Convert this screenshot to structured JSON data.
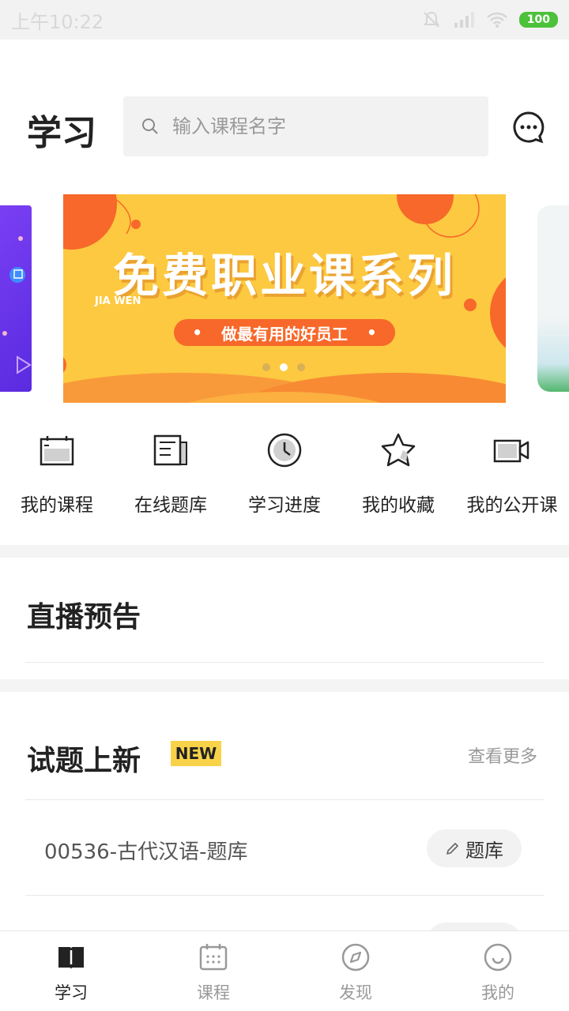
{
  "status_bar": {
    "time": "上午10:22",
    "battery": "100"
  },
  "header": {
    "title": "学习",
    "search_placeholder": "输入课程名字"
  },
  "banner": {
    "headline": "免费职业课系列",
    "subtext": "JIA WEN",
    "tagline": "做最有用的好员工",
    "active_dot": 1
  },
  "shortcuts": [
    {
      "label": "我的课程",
      "icon": "course-icon"
    },
    {
      "label": "在线题库",
      "icon": "question-bank-icon"
    },
    {
      "label": "学习进度",
      "icon": "clock-icon"
    },
    {
      "label": "我的收藏",
      "icon": "star-icon"
    },
    {
      "label": "我的公开课",
      "icon": "video-camera-icon"
    }
  ],
  "live": {
    "title": "直播预告"
  },
  "new_questions": {
    "title": "试题上新",
    "badge": "NEW",
    "more": "查看更多",
    "items": [
      {
        "title": "00536-古代汉语-题库",
        "tag": "题库"
      }
    ]
  },
  "tabbar": [
    {
      "label": "学习",
      "icon": "book-icon",
      "active": true
    },
    {
      "label": "课程",
      "icon": "calendar-icon",
      "active": false
    },
    {
      "label": "发现",
      "icon": "compass-icon",
      "active": false
    },
    {
      "label": "我的",
      "icon": "smile-icon",
      "active": false
    }
  ],
  "colors": {
    "accent": "#fcc940",
    "orange": "#f7682a",
    "badge": "#f8d249"
  }
}
